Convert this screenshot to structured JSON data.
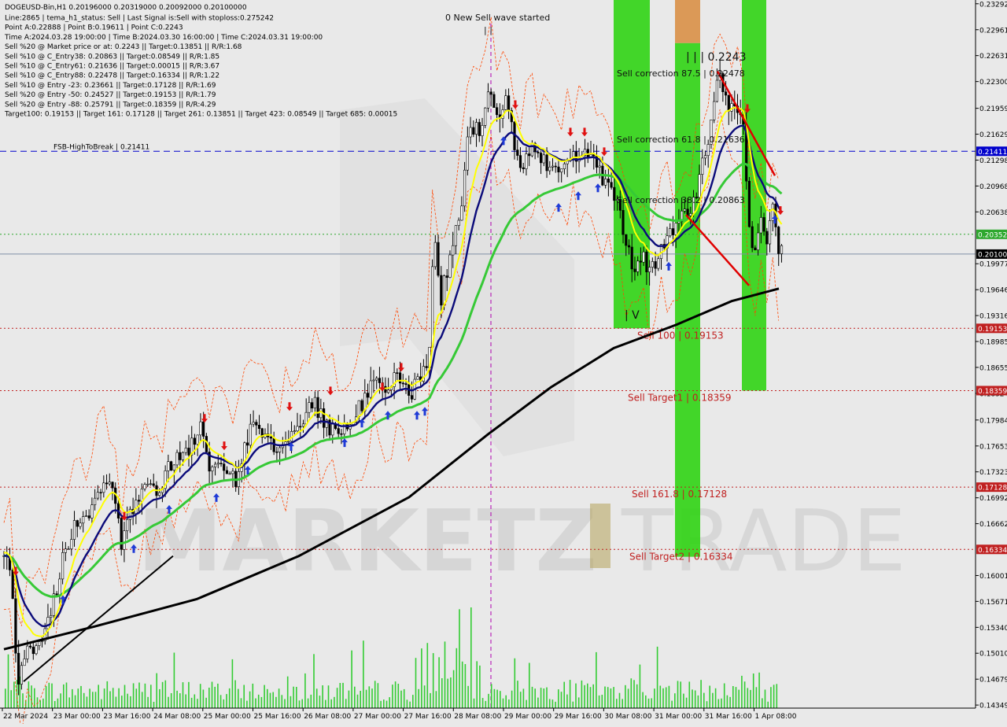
{
  "header": {
    "title": "DOGEUSD-Bin,H1  0.20196000 0.20319000 0.20092000 0.20100000",
    "lines": [
      "Line:2865 | tema_h1_status: Sell | Last Signal is:Sell with stoploss:0.275242",
      "Point A:0.22888 | Point B:0.19611 | Point C:0.2243",
      "Time A:2024.03.28 19:00:00 | Time B:2024.03.30 16:00:00 | Time C:2024.03.31 19:00:00",
      "Sell %20 @ Market price or at: 0.2243 || Target:0.13851 || R/R:1.68",
      "Sell %10 @ C_Entry38: 0.20863 || Target:0.08549 || R/R:1.85",
      "Sell %10 @ C_Entry61: 0.21636 || Target:0.00015 || R/R:3.67",
      "Sell %10 @ C_Entry88: 0.22478 || Target:0.16334 || R/R:1.22",
      "Sell %10 @ Entry -23: 0.23661 || Target:0.17128 || R/R:1.69",
      "Sell %20 @ Entry -50: 0.24527 || Target:0.19153 || R/R:1.79",
      "Sell %20 @ Entry -88: 0.25791 || Target:0.18359 || R/R:4.29",
      "Target100: 0.19153 || Target 161: 0.17128 || Target 261: 0.13851 || Target 423: 0.08549 || Target 685: 0.00015"
    ]
  },
  "watermark": {
    "text_left": "MARKETZ",
    "text_right": "TRADE"
  },
  "colors": {
    "background": "#e9e9e9",
    "bull": "#2f8f2f",
    "bear": "#000000",
    "ema_green": "#36c936",
    "ema_navy": "#0b0b7a",
    "ema_yellow": "#ffff00",
    "ma_black": "#000000",
    "level_red": "#c02020",
    "level_green": "#2ea82e",
    "level_blue": "#0000cc",
    "zone_green": "#33d418",
    "zone_orange": "#d9914a",
    "volume": "#33cc33",
    "channel": "#ff4500"
  },
  "chart_data": {
    "type": "candlestick",
    "symbol": "DOGEUSD-Bin",
    "timeframe": "H1",
    "ohlc_last": {
      "open": 0.20196,
      "high": 0.20319,
      "low": 0.20092,
      "close": 0.201
    },
    "ylim": [
      0.1431,
      0.2334
    ],
    "x_ticks": [
      "22 Mar 2024",
      "23 Mar 00:00",
      "23 Mar 16:00",
      "24 Mar 08:00",
      "25 Mar 00:00",
      "25 Mar 16:00",
      "26 Mar 08:00",
      "27 Mar 00:00",
      "27 Mar 16:00",
      "28 Mar 08:00",
      "29 Mar 00:00",
      "29 Mar 16:00",
      "30 Mar 08:00",
      "31 Mar 00:00",
      "31 Mar 16:00",
      "1 Apr 08:00"
    ],
    "y_ticks": [
      "0.23292",
      "0.22961",
      "0.22631",
      "0.22300",
      "0.21959",
      "0.21629",
      "0.21298",
      "0.20968",
      "0.20638",
      "0.19977",
      "0.19646",
      "0.19316",
      "0.18985",
      "0.18655",
      "0.18324",
      "0.17984",
      "0.17653",
      "0.17323",
      "0.16992",
      "0.16662",
      "0.16001",
      "0.15671",
      "0.15340",
      "0.15010",
      "0.14679",
      "0.14349"
    ],
    "price_tags": [
      {
        "label": "0.21411",
        "value": 0.21411,
        "color": "#0000cc"
      },
      {
        "label": "0.20352",
        "value": 0.20352,
        "color": "#2ea82e"
      },
      {
        "label": "0.20100",
        "value": 0.201,
        "color": "#000000"
      },
      {
        "label": "0.19153",
        "value": 0.19153,
        "color": "#c02020"
      },
      {
        "label": "0.18359",
        "value": 0.18359,
        "color": "#c02020"
      },
      {
        "label": "0.17128",
        "value": 0.17128,
        "color": "#c02020"
      },
      {
        "label": "0.16334",
        "value": 0.16334,
        "color": "#c02020"
      }
    ],
    "levels": [
      {
        "name": "fsb",
        "value": 0.21411,
        "color": "#0000cc",
        "style": "dashed",
        "label": "FSB-HighToBreak  |  0.21411"
      },
      {
        "name": "green",
        "value": 0.20352,
        "color": "#2ea82e",
        "style": "dotted",
        "label": ""
      },
      {
        "name": "current",
        "value": 0.201,
        "color": "#7f8fa6",
        "style": "solid",
        "label": ""
      },
      {
        "name": "sell100",
        "value": 0.19153,
        "color": "#c02020",
        "style": "dotted",
        "label": "Sell 100  |  0.19153"
      },
      {
        "name": "target1",
        "value": 0.18359,
        "color": "#c02020",
        "style": "dotted",
        "label": "Sell Target1  |  0.18359"
      },
      {
        "name": "sell161",
        "value": 0.17128,
        "color": "#c02020",
        "style": "dotted",
        "label": "Sell 161.8  |  0.17128"
      },
      {
        "name": "target2",
        "value": 0.16334,
        "color": "#c02020",
        "style": "dotted",
        "label": "Sell Target2  |  0.16334"
      }
    ],
    "annotations": [
      {
        "name": "wave-label",
        "text": "0 New Sell wave started"
      },
      {
        "name": "wave-marks",
        "text": "| |"
      },
      {
        "name": "point-c-label",
        "text": "| | | 0.2243"
      },
      {
        "name": "point-b-label",
        "text": "| V"
      },
      {
        "name": "corr-875",
        "text": "Sell correction 87.5 | 0.22478"
      },
      {
        "name": "corr-618",
        "text": "Sell correction 61.8 | 0.21636"
      },
      {
        "name": "corr-382",
        "text": "Sell correction 38.2 | 0.20863"
      }
    ],
    "zones": [
      {
        "name": "zone-green-1",
        "start": 0.2334,
        "end": 0.19153,
        "color": "#33d418"
      },
      {
        "name": "zone-orange",
        "start": 0.2334,
        "end": 0.2279,
        "color": "#d9914a"
      },
      {
        "name": "zone-green-2",
        "start": 0.2279,
        "end": 0.1624,
        "color": "#33d418"
      },
      {
        "name": "zone-green-3",
        "start": 0.2334,
        "end": 0.18359,
        "color": "#33d418"
      }
    ],
    "series": [
      {
        "type": "candlestick",
        "points": 266
      },
      {
        "type": "line",
        "color": "#36c936"
      },
      {
        "type": "line",
        "color": "#0b0b7a"
      },
      {
        "type": "line",
        "color": "#ffff00"
      },
      {
        "type": "line",
        "color": "#000000"
      },
      {
        "type": "volume"
      }
    ]
  }
}
